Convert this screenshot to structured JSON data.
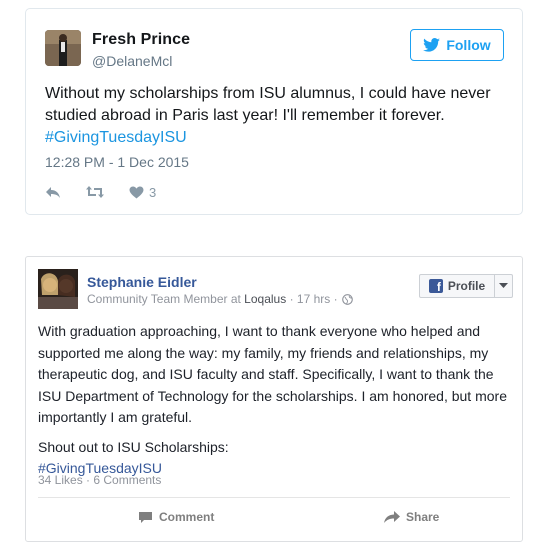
{
  "tweet": {
    "name": "Fresh Prince",
    "handle": "@DelaneMcl",
    "follow_label": "Follow",
    "text_lines": [
      "Without my scholarships from ISU alumnus, I could have never",
      "studied abroad in Paris last year! I'll remember it forever."
    ],
    "hashtag": "#GivingTuesdayISU",
    "timestamp": "12:28 PM - 1 Dec 2015",
    "like_count": "3",
    "accent_color": "#1da1f2"
  },
  "fb_post": {
    "name": "Stephanie Eidler",
    "role": "Community Team Member at",
    "organization": "Loqalus",
    "time": "17 hrs",
    "separator": "·",
    "profile_label": "Profile",
    "body_lines": [
      "With graduation approaching, I want to thank everyone who helped and",
      "supported me along the way: my family, my friends and relationships, my",
      "therapeutic dog, and ISU faculty and staff. Specifically, I want to thank the",
      "ISU Department of Technology for the scholarships. I am honored, but more",
      "importantly I am grateful."
    ],
    "shoutout": "Shout out to ISU Scholarships:",
    "hashtag": "#GivingTuesdayISU",
    "stats": "34 Likes · 6 Comments",
    "comment_label": "Comment",
    "share_label": "Share",
    "accent_color": "#365899"
  }
}
